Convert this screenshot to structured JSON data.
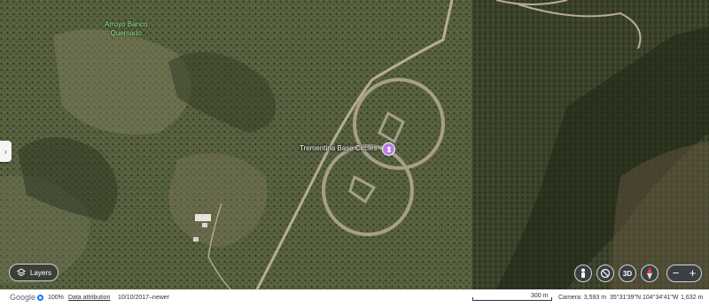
{
  "map": {
    "place_label_line1": "Arroyo Banco",
    "place_label_line2": "Quemado",
    "poi_label": "Trementina Base Circles",
    "poi_icon": "marker-icon",
    "colors": {
      "terrain_dark": "#3e4a30",
      "terrain_mid": "#56603f",
      "terrain_light": "#8a8766",
      "road": "#b7ad93",
      "poi_pin": "#b97ce4",
      "label_green": "#9be38f"
    }
  },
  "controls": {
    "sidebar_toggle": "›",
    "layers_label": "Layers",
    "tilt_label": "3D",
    "zoom_out": "−",
    "zoom_in": "+",
    "pegman_icon": "pegman-icon",
    "no_entry_icon": "rotate-icon",
    "compass_icon": "compass-icon"
  },
  "bottom_bar": {
    "logo": "Google",
    "zoom_percent": "100%",
    "data_attribution": "Data attribution",
    "imagery_date": "10/10/2017–newer",
    "scale_label": "300 m",
    "camera": "Camera: 3,593 m",
    "coordinates": "35°31'39\"N 104°34'41\"W",
    "elevation": "1,632 m"
  }
}
